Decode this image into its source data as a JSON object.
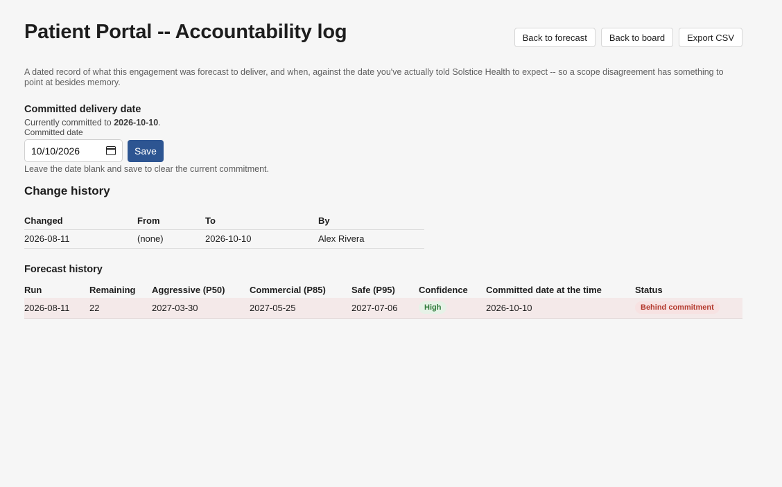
{
  "header": {
    "title": "Patient Portal -- Accountability log",
    "actions": [
      "Back to forecast",
      "Back to board",
      "Export CSV"
    ]
  },
  "intro": "A dated record of what this engagement was forecast to deliver, and when, against the date you've actually told Solstice Health to expect -- so a scope disagreement has something to point at besides memory.",
  "commitment": {
    "heading": "Committed delivery date",
    "current_prefix": "Currently committed to ",
    "current_value": "2026-10-10",
    "current_suffix": ".",
    "field_label": "Committed date",
    "field_value": "10/10/2026",
    "save_label": "Save",
    "hint": "Leave the date blank and save to clear the current commitment."
  },
  "change_history": {
    "heading": "Change history",
    "columns": [
      "Changed",
      "From",
      "To",
      "By"
    ],
    "rows": [
      [
        "2026-08-11",
        "(none)",
        "2026-10-10",
        "Alex Rivera"
      ]
    ]
  },
  "forecast_history": {
    "heading": "Forecast history",
    "columns": [
      "Run",
      "Remaining",
      "Aggressive (P50)",
      "Commercial (P85)",
      "Safe (P95)",
      "Confidence",
      "Committed date at the time",
      "Status"
    ],
    "rows": [
      {
        "run": "2026-08-11",
        "remaining": "22",
        "p50": "2027-03-30",
        "p85": "2027-05-25",
        "p95": "2027-07-06",
        "confidence": "High",
        "committed": "2026-10-10",
        "status": "Behind commitment"
      }
    ]
  },
  "colors": {
    "primary": "#2d5592",
    "confidence_high": "#2f7a3a",
    "status_behind": "#b2372b",
    "row_behind_bg": "#f4e9e9"
  }
}
